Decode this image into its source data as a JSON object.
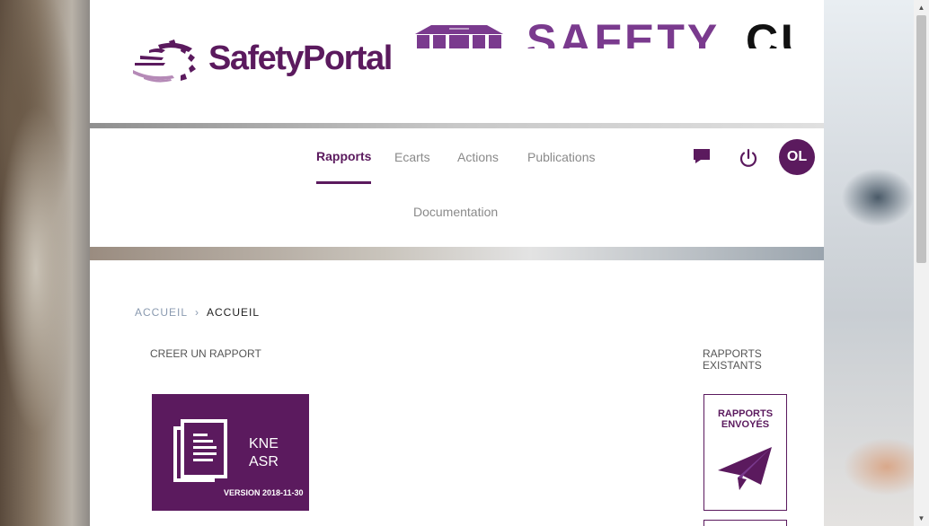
{
  "header": {
    "logo_text": "SafetyPortal",
    "partner_logo_text_1": "SAFETY",
    "partner_logo_text_2": "CUBE"
  },
  "nav": {
    "tabs": [
      {
        "label": "Rapports",
        "active": true
      },
      {
        "label": "Ecarts",
        "active": false
      },
      {
        "label": "Actions",
        "active": false
      },
      {
        "label": "Publications",
        "active": false
      },
      {
        "label": "Documentation",
        "active": false
      }
    ],
    "icons": [
      "message-icon",
      "power-icon"
    ],
    "avatar_initials": "OL"
  },
  "breadcrumb": {
    "items": [
      "ACCUEIL",
      "ACCUEIL"
    ]
  },
  "sections": {
    "create_title": "CREER UN RAPPORT",
    "existing_title": "RAPPORTS EXISTANTS"
  },
  "report_card": {
    "line1": "KNE",
    "line2": "ASR",
    "version": "VERSION 2018-11-30"
  },
  "sent_card": {
    "label": "RAPPORTS ENVOYÉS"
  },
  "colors": {
    "brand": "#5b1a5e",
    "partner_purple": "#7a3a8e",
    "muted_text": "#8a8a8a"
  }
}
